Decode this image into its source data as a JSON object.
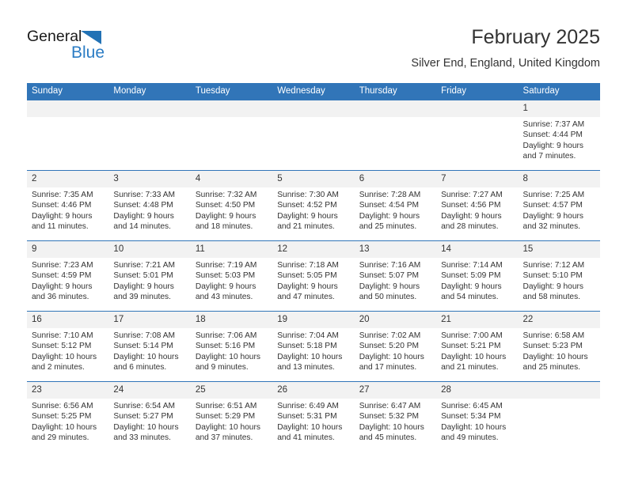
{
  "brand": {
    "word_one": "General",
    "word_two": "Blue",
    "triangle_icon": "triangle-icon",
    "accent_color": "#2b7cc4"
  },
  "header": {
    "title": "February 2025",
    "subtitle": "Silver End, England, United Kingdom"
  },
  "theme": {
    "header_blue": "#3175b8",
    "daynum_band": "#f2f2f2",
    "text": "#333333"
  },
  "calendar": {
    "weekday_headers": [
      "Sunday",
      "Monday",
      "Tuesday",
      "Wednesday",
      "Thursday",
      "Friday",
      "Saturday"
    ],
    "labels": {
      "sunrise": "Sunrise:",
      "sunset": "Sunset:",
      "daylight": "Daylight:"
    },
    "weeks": [
      [
        {
          "day": "",
          "empty": true
        },
        {
          "day": "",
          "empty": true
        },
        {
          "day": "",
          "empty": true
        },
        {
          "day": "",
          "empty": true
        },
        {
          "day": "",
          "empty": true
        },
        {
          "day": "",
          "empty": true
        },
        {
          "day": "1",
          "sunrise": "Sunrise: 7:37 AM",
          "sunset": "Sunset: 4:44 PM",
          "daylight_line1": "Daylight: 9 hours",
          "daylight_line2": "and 7 minutes."
        }
      ],
      [
        {
          "day": "2",
          "sunrise": "Sunrise: 7:35 AM",
          "sunset": "Sunset: 4:46 PM",
          "daylight_line1": "Daylight: 9 hours",
          "daylight_line2": "and 11 minutes."
        },
        {
          "day": "3",
          "sunrise": "Sunrise: 7:33 AM",
          "sunset": "Sunset: 4:48 PM",
          "daylight_line1": "Daylight: 9 hours",
          "daylight_line2": "and 14 minutes."
        },
        {
          "day": "4",
          "sunrise": "Sunrise: 7:32 AM",
          "sunset": "Sunset: 4:50 PM",
          "daylight_line1": "Daylight: 9 hours",
          "daylight_line2": "and 18 minutes."
        },
        {
          "day": "5",
          "sunrise": "Sunrise: 7:30 AM",
          "sunset": "Sunset: 4:52 PM",
          "daylight_line1": "Daylight: 9 hours",
          "daylight_line2": "and 21 minutes."
        },
        {
          "day": "6",
          "sunrise": "Sunrise: 7:28 AM",
          "sunset": "Sunset: 4:54 PM",
          "daylight_line1": "Daylight: 9 hours",
          "daylight_line2": "and 25 minutes."
        },
        {
          "day": "7",
          "sunrise": "Sunrise: 7:27 AM",
          "sunset": "Sunset: 4:56 PM",
          "daylight_line1": "Daylight: 9 hours",
          "daylight_line2": "and 28 minutes."
        },
        {
          "day": "8",
          "sunrise": "Sunrise: 7:25 AM",
          "sunset": "Sunset: 4:57 PM",
          "daylight_line1": "Daylight: 9 hours",
          "daylight_line2": "and 32 minutes."
        }
      ],
      [
        {
          "day": "9",
          "sunrise": "Sunrise: 7:23 AM",
          "sunset": "Sunset: 4:59 PM",
          "daylight_line1": "Daylight: 9 hours",
          "daylight_line2": "and 36 minutes."
        },
        {
          "day": "10",
          "sunrise": "Sunrise: 7:21 AM",
          "sunset": "Sunset: 5:01 PM",
          "daylight_line1": "Daylight: 9 hours",
          "daylight_line2": "and 39 minutes."
        },
        {
          "day": "11",
          "sunrise": "Sunrise: 7:19 AM",
          "sunset": "Sunset: 5:03 PM",
          "daylight_line1": "Daylight: 9 hours",
          "daylight_line2": "and 43 minutes."
        },
        {
          "day": "12",
          "sunrise": "Sunrise: 7:18 AM",
          "sunset": "Sunset: 5:05 PM",
          "daylight_line1": "Daylight: 9 hours",
          "daylight_line2": "and 47 minutes."
        },
        {
          "day": "13",
          "sunrise": "Sunrise: 7:16 AM",
          "sunset": "Sunset: 5:07 PM",
          "daylight_line1": "Daylight: 9 hours",
          "daylight_line2": "and 50 minutes."
        },
        {
          "day": "14",
          "sunrise": "Sunrise: 7:14 AM",
          "sunset": "Sunset: 5:09 PM",
          "daylight_line1": "Daylight: 9 hours",
          "daylight_line2": "and 54 minutes."
        },
        {
          "day": "15",
          "sunrise": "Sunrise: 7:12 AM",
          "sunset": "Sunset: 5:10 PM",
          "daylight_line1": "Daylight: 9 hours",
          "daylight_line2": "and 58 minutes."
        }
      ],
      [
        {
          "day": "16",
          "sunrise": "Sunrise: 7:10 AM",
          "sunset": "Sunset: 5:12 PM",
          "daylight_line1": "Daylight: 10 hours",
          "daylight_line2": "and 2 minutes."
        },
        {
          "day": "17",
          "sunrise": "Sunrise: 7:08 AM",
          "sunset": "Sunset: 5:14 PM",
          "daylight_line1": "Daylight: 10 hours",
          "daylight_line2": "and 6 minutes."
        },
        {
          "day": "18",
          "sunrise": "Sunrise: 7:06 AM",
          "sunset": "Sunset: 5:16 PM",
          "daylight_line1": "Daylight: 10 hours",
          "daylight_line2": "and 9 minutes."
        },
        {
          "day": "19",
          "sunrise": "Sunrise: 7:04 AM",
          "sunset": "Sunset: 5:18 PM",
          "daylight_line1": "Daylight: 10 hours",
          "daylight_line2": "and 13 minutes."
        },
        {
          "day": "20",
          "sunrise": "Sunrise: 7:02 AM",
          "sunset": "Sunset: 5:20 PM",
          "daylight_line1": "Daylight: 10 hours",
          "daylight_line2": "and 17 minutes."
        },
        {
          "day": "21",
          "sunrise": "Sunrise: 7:00 AM",
          "sunset": "Sunset: 5:21 PM",
          "daylight_line1": "Daylight: 10 hours",
          "daylight_line2": "and 21 minutes."
        },
        {
          "day": "22",
          "sunrise": "Sunrise: 6:58 AM",
          "sunset": "Sunset: 5:23 PM",
          "daylight_line1": "Daylight: 10 hours",
          "daylight_line2": "and 25 minutes."
        }
      ],
      [
        {
          "day": "23",
          "sunrise": "Sunrise: 6:56 AM",
          "sunset": "Sunset: 5:25 PM",
          "daylight_line1": "Daylight: 10 hours",
          "daylight_line2": "and 29 minutes."
        },
        {
          "day": "24",
          "sunrise": "Sunrise: 6:54 AM",
          "sunset": "Sunset: 5:27 PM",
          "daylight_line1": "Daylight: 10 hours",
          "daylight_line2": "and 33 minutes."
        },
        {
          "day": "25",
          "sunrise": "Sunrise: 6:51 AM",
          "sunset": "Sunset: 5:29 PM",
          "daylight_line1": "Daylight: 10 hours",
          "daylight_line2": "and 37 minutes."
        },
        {
          "day": "26",
          "sunrise": "Sunrise: 6:49 AM",
          "sunset": "Sunset: 5:31 PM",
          "daylight_line1": "Daylight: 10 hours",
          "daylight_line2": "and 41 minutes."
        },
        {
          "day": "27",
          "sunrise": "Sunrise: 6:47 AM",
          "sunset": "Sunset: 5:32 PM",
          "daylight_line1": "Daylight: 10 hours",
          "daylight_line2": "and 45 minutes."
        },
        {
          "day": "28",
          "sunrise": "Sunrise: 6:45 AM",
          "sunset": "Sunset: 5:34 PM",
          "daylight_line1": "Daylight: 10 hours",
          "daylight_line2": "and 49 minutes."
        },
        {
          "day": "",
          "empty": true
        }
      ]
    ]
  }
}
